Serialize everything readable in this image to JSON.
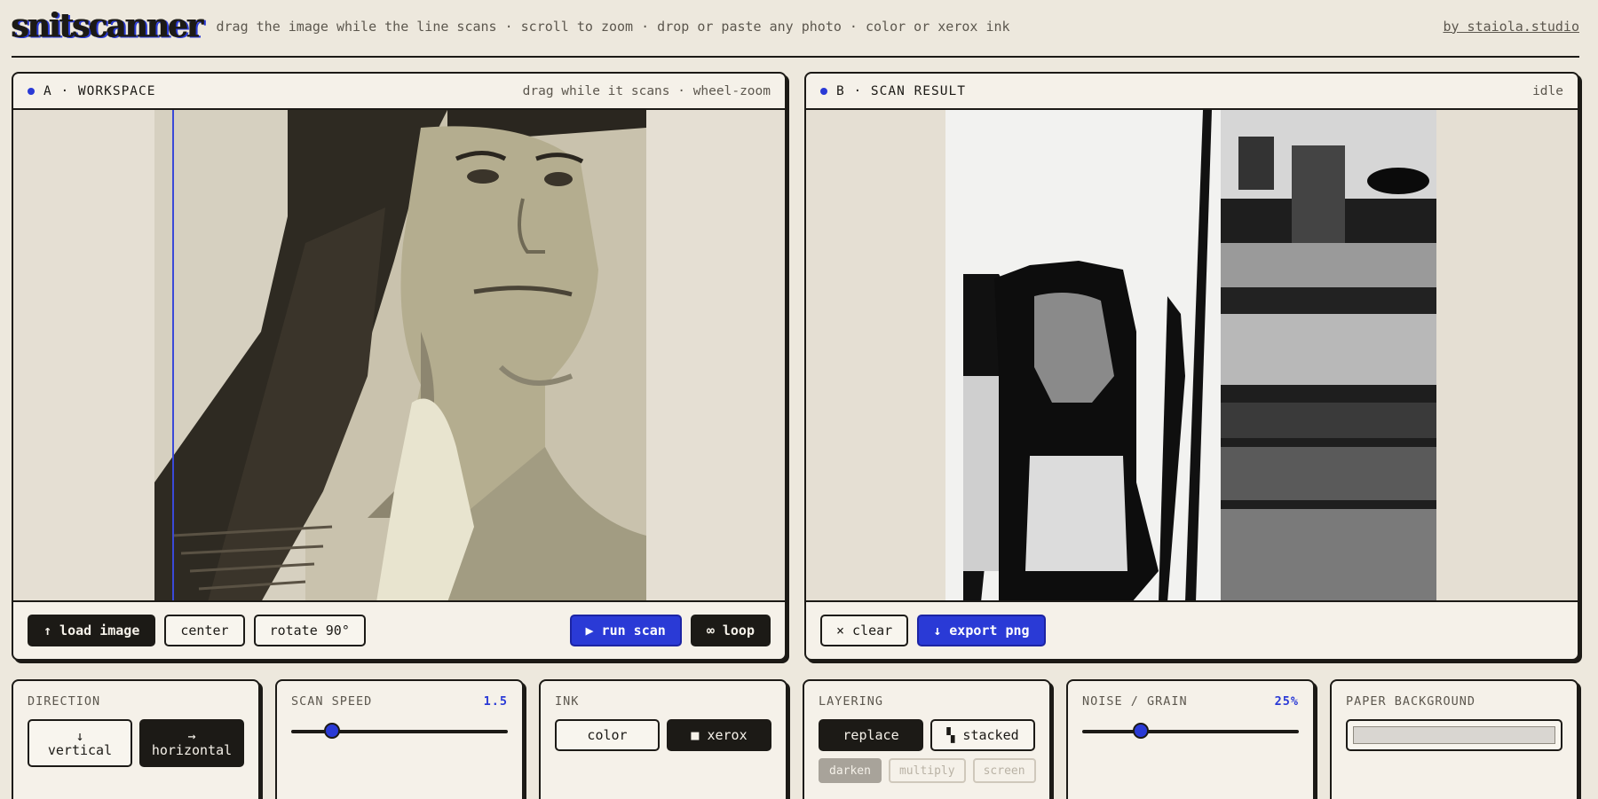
{
  "header": {
    "logo": "snitscanner",
    "tagline": "drag the image while the line scans · scroll to zoom · drop or paste any photo · color or xerox ink",
    "author": "by staiola.studio"
  },
  "workspace": {
    "title": "A · WORKSPACE",
    "hint": "drag while it scans · wheel-zoom",
    "buttons": {
      "load": "↑ load image",
      "center": "center",
      "rotate": "rotate 90°",
      "run": "▶ run scan",
      "loop": "∞ loop"
    }
  },
  "result": {
    "title": "B · SCAN RESULT",
    "status": "idle",
    "buttons": {
      "clear": "× clear",
      "export": "↓ export png"
    }
  },
  "controls": {
    "direction": {
      "label": "DIRECTION",
      "options": [
        {
          "arrow": "↓",
          "label": "vertical"
        },
        {
          "arrow": "→",
          "label": "horizontal"
        }
      ],
      "selected": "horizontal"
    },
    "scan_speed": {
      "label": "SCAN SPEED",
      "value": "1.5",
      "fraction": 0.19
    },
    "ink": {
      "label": "INK",
      "options": [
        "color",
        "■ xerox"
      ],
      "selected": "■ xerox"
    },
    "layering": {
      "label": "LAYERING",
      "options": [
        "replace",
        "▚ stacked"
      ],
      "selected": "replace",
      "blend_modes": [
        "darken",
        "multiply",
        "screen"
      ],
      "blend_selected": "darken"
    },
    "noise": {
      "label": "NOISE / GRAIN",
      "value": "25%",
      "fraction": 0.27
    },
    "paper": {
      "label": "PAPER BACKGROUND",
      "color": "#d9d6d1"
    }
  },
  "colors": {
    "accent": "#2a3ad6",
    "ink": "#1c1a16",
    "paper": "#f5f1e9"
  }
}
